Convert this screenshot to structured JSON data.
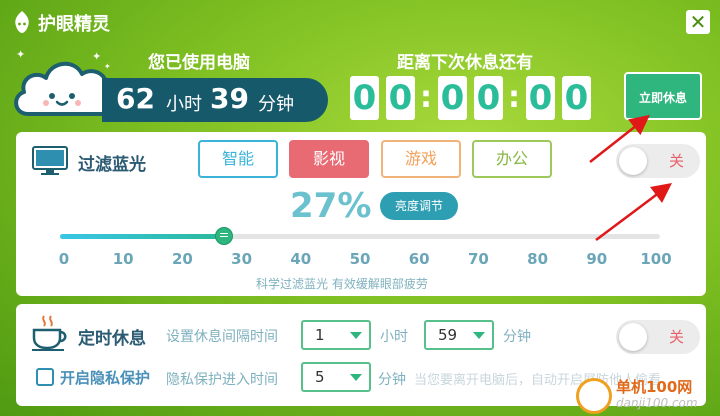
{
  "app": {
    "title": "护眼精灵",
    "close_symbol": "✕"
  },
  "usage": {
    "label": "您已使用电脑",
    "hours": "62",
    "hours_unit": "小时",
    "minutes": "39",
    "minutes_unit": "分钟"
  },
  "countdown": {
    "label": "距离下次休息还有",
    "digits": [
      "0",
      "0",
      "0",
      "0",
      "0",
      "0"
    ],
    "separator": ":",
    "rest_now_label": "立即休息"
  },
  "filter": {
    "title": "过滤蓝光",
    "modes": [
      {
        "label": "智能",
        "color": "#3bb3d9"
      },
      {
        "label": "影视",
        "color": "#e86b74",
        "active": true
      },
      {
        "label": "游戏",
        "color": "#f2b37a"
      },
      {
        "label": "办公",
        "color": "#9cc95a"
      }
    ],
    "toggle_label": "关",
    "percent": 27,
    "percent_text": "27%",
    "brightness_label": "亮度调节",
    "ticks": [
      "0",
      "10",
      "20",
      "30",
      "40",
      "50",
      "60",
      "70",
      "80",
      "90",
      "100"
    ],
    "note": "科学过滤蓝光 有效缓解眼部疲劳"
  },
  "timer": {
    "title": "定时休息",
    "interval_label": "设置休息间隔时间",
    "hours_value": "1",
    "hours_unit": "小时",
    "minutes_value": "59",
    "minutes_unit": "分钟",
    "toggle_label": "关",
    "privacy_label": "开启隐私保护",
    "privacy_enter_label": "隐私保护进入时间",
    "privacy_value": "5",
    "privacy_unit": "分钟",
    "privacy_hint": "当您要离开电脑后，自动开启屏防他人偷看"
  },
  "watermark": {
    "name": "单机100网",
    "url": "danji100.com"
  },
  "colors": {
    "accent": "#2fb57e",
    "pill": "#15596b",
    "off": "#e6606a"
  }
}
